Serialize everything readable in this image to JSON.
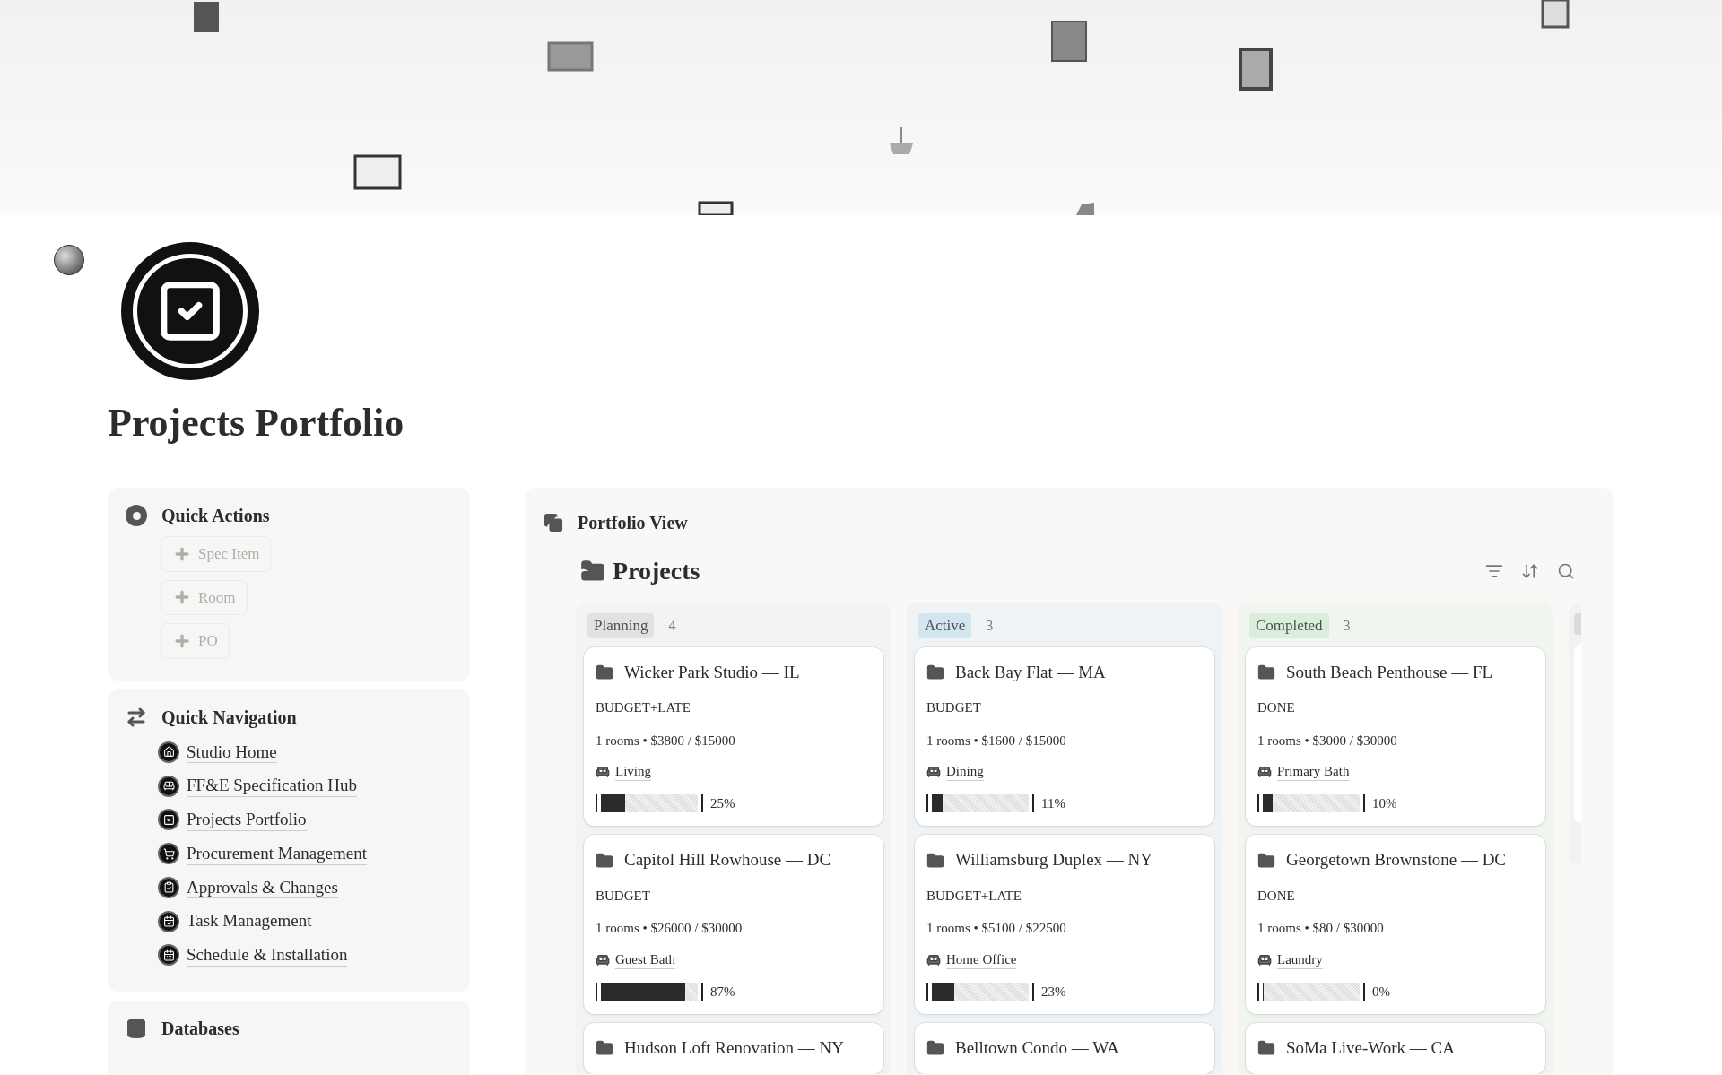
{
  "page": {
    "title": "Projects Portfolio"
  },
  "quick_actions": {
    "title": "Quick Actions",
    "buttons": [
      "Spec Item",
      "Room",
      "PO"
    ]
  },
  "quick_navigation": {
    "title": "Quick Navigation",
    "links": [
      "Studio Home",
      "FF&E Specification Hub",
      "Projects Portfolio",
      "Procurement Management",
      "Approvals & Changes",
      "Task Management",
      "Schedule & Installation"
    ]
  },
  "databases": {
    "title": "Databases"
  },
  "portfolio_view": {
    "title": "Portfolio View",
    "database_title": "Projects",
    "groups": [
      {
        "label": "Planning",
        "count": "4",
        "color": "#e3e2e0",
        "cards": [
          {
            "title": "Wicker Park Studio — IL",
            "flags": "BUDGET+LATE",
            "summary": "1 rooms • $3800 / $15000",
            "room": "Living",
            "level": 0.25,
            "reading": "25%"
          },
          {
            "title": "Capitol Hill Rowhouse — DC",
            "flags": "BUDGET",
            "summary": "1 rooms • $26000 / $30000",
            "room": "Guest Bath",
            "level": 0.87,
            "reading": "87%"
          },
          {
            "title": "Hudson Loft Renovation — NY"
          }
        ]
      },
      {
        "label": "Active",
        "count": "3",
        "color": "#d3e5ef",
        "cards": [
          {
            "title": "Back Bay Flat — MA",
            "flags": "BUDGET",
            "summary": "1 rooms • $1600 / $15000",
            "room": "Dining",
            "level": 0.11,
            "reading": "11%"
          },
          {
            "title": "Williamsburg Duplex — NY",
            "flags": "BUDGET+LATE",
            "summary": "1 rooms • $5100 / $22500",
            "room": "Home Office",
            "level": 0.23,
            "reading": "23%"
          },
          {
            "title": "Belltown Condo — WA"
          }
        ]
      },
      {
        "label": "Completed",
        "count": "3",
        "color": "#dbeddb",
        "cards": [
          {
            "title": "South Beach Penthouse — FL",
            "flags": "DONE",
            "summary": "1 rooms • $3000 / $30000",
            "room": "Primary Bath",
            "level": 0.1,
            "reading": "10%"
          },
          {
            "title": "Georgetown Brownstone — DC",
            "flags": "DONE",
            "summary": "1 rooms • $80 / $30000",
            "room": "Laundry",
            "level": 0,
            "reading": "0%"
          },
          {
            "title": "SoMa Live-Work — CA"
          }
        ]
      }
    ]
  }
}
